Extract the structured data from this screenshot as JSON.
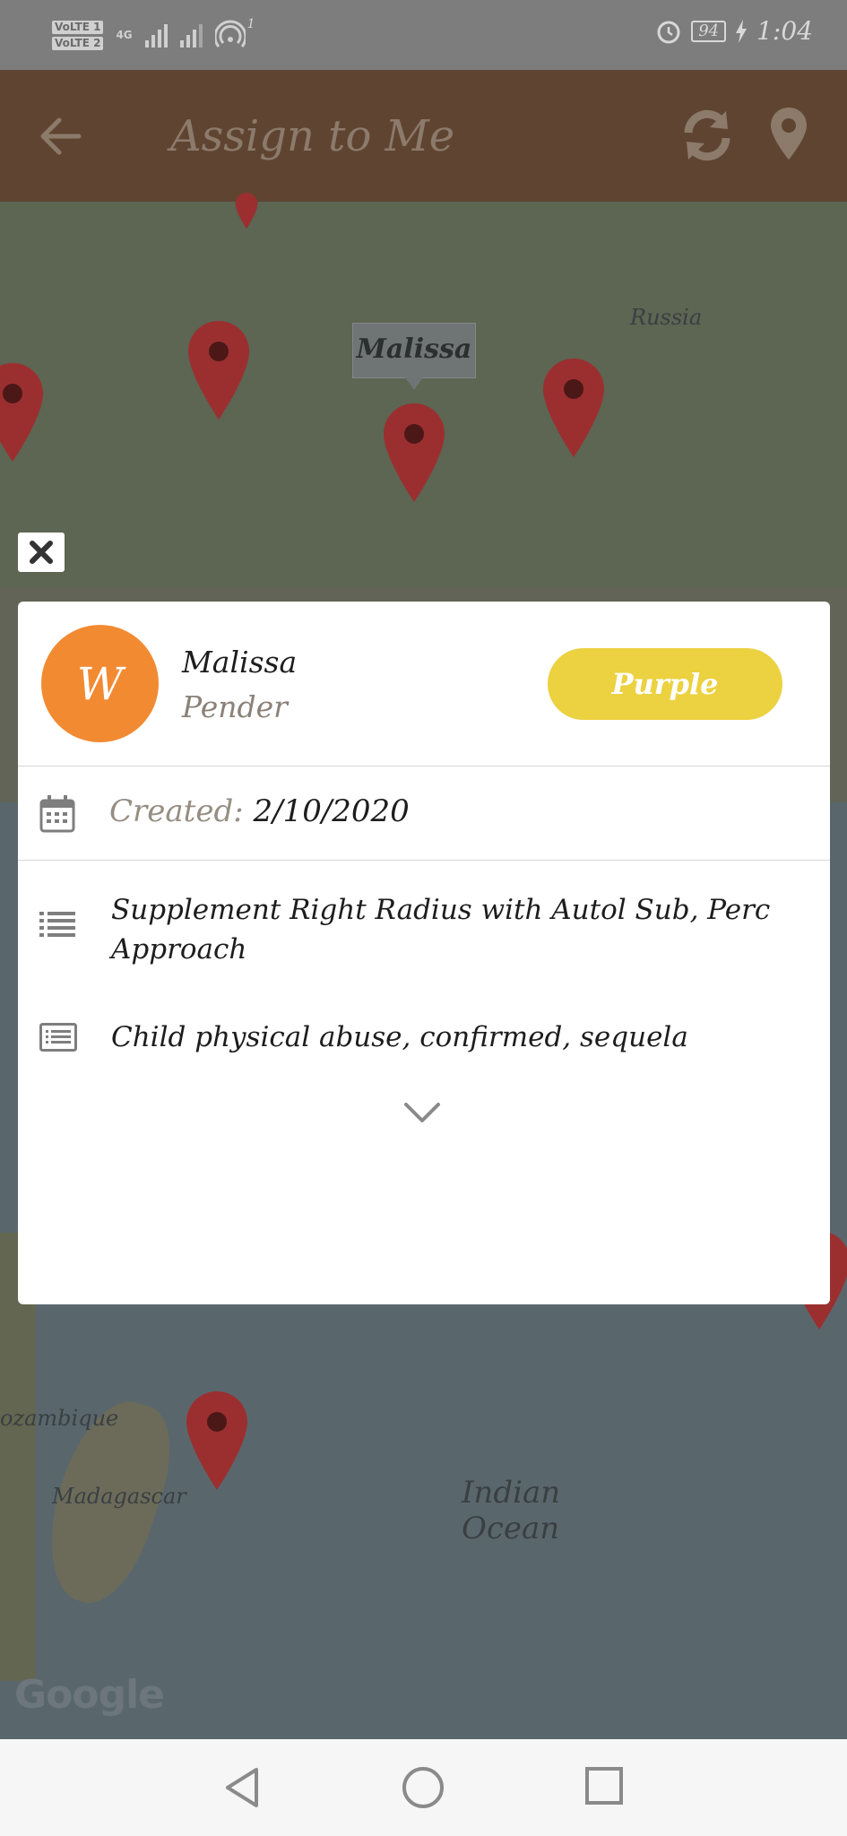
{
  "status_bar": {
    "sim1": "VoLTE 1",
    "sim2": "VoLTE 2",
    "network": "4G",
    "notification_count": "1",
    "battery": "94",
    "time": "1:04"
  },
  "app_bar": {
    "title": "Assign to Me",
    "icons": [
      "back-arrow-icon",
      "refresh-icon",
      "location-pin-icon"
    ]
  },
  "map": {
    "labels": {
      "russia": "Russia",
      "mozambique": "ozambique",
      "madagascar": "Madagascar",
      "ocean_line1": "Indian",
      "ocean_line2": "Ocean"
    },
    "selected_marker": "Malissa",
    "attribution": "Google"
  },
  "card": {
    "avatar_initial": "W",
    "first_name": "Malissa",
    "last_name": "Pender",
    "tag": {
      "label": "Purple",
      "color": "#ecd140"
    },
    "created_label": "Created:",
    "created_date": "2/10/2020",
    "procedure": "Supplement Right Radius with Autol Sub, Perc Approach",
    "diagnosis": "Child physical abuse, confirmed, sequela"
  },
  "colors": {
    "app_bar": "#5f4531",
    "avatar": "#f28a32",
    "pin": "#9b2f2f"
  }
}
